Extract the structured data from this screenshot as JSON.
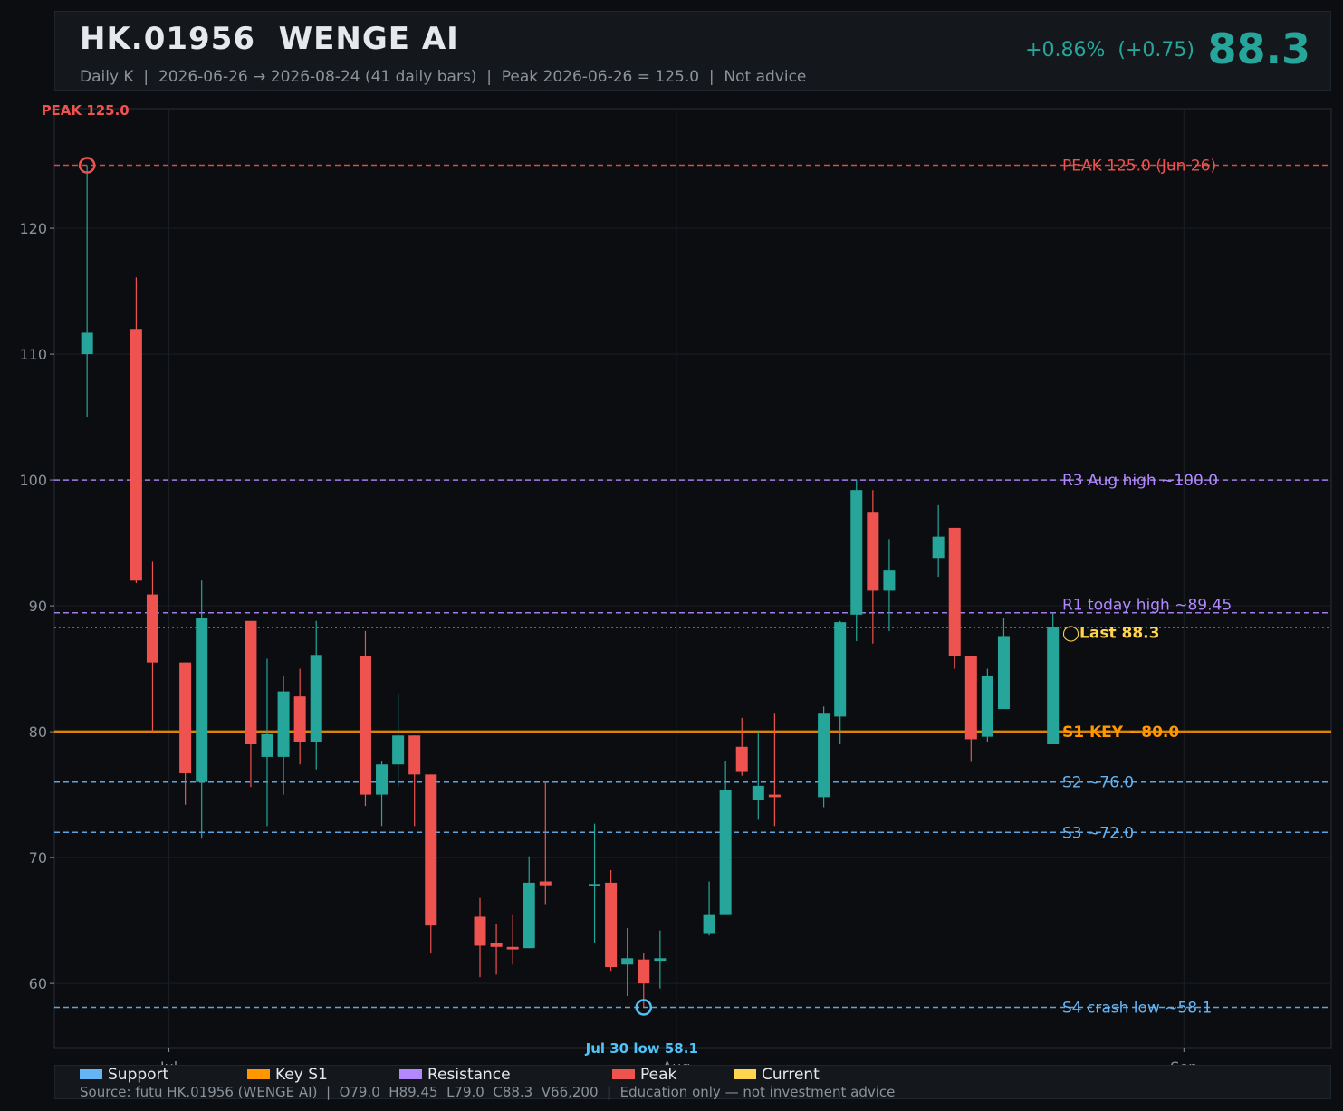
{
  "header": {
    "title": "HK.01956  WENGE AI",
    "subtitle": "Daily K  |  2026-06-26 → 2026-08-24 (41 daily bars)  |  Peak 2026-06-26 = 125.0  |  Not advice",
    "change": "+0.86%  (+0.75)",
    "price": "88.3"
  },
  "chart_data": {
    "type": "candlestick",
    "ylim": [
      54.9,
      129.5
    ],
    "yticks": [
      60,
      70,
      80,
      90,
      100,
      110,
      120
    ],
    "xticks": [
      {
        "label": "Jul",
        "date": "2026-07-01"
      },
      {
        "label": "Aug",
        "date": "2026-08-01"
      },
      {
        "label": "Sep",
        "date": "2026-09-01"
      }
    ],
    "x_range": [
      "2026-06-24",
      "2026-09-10"
    ],
    "grid": true,
    "candles": [
      {
        "date": "2026-06-26",
        "open": 110.0,
        "high": 125.0,
        "low": 105.0,
        "close": 111.7
      },
      {
        "date": "2026-06-29",
        "open": 112.0,
        "high": 116.1,
        "low": 91.8,
        "close": 92.0
      },
      {
        "date": "2026-06-30",
        "open": 90.9,
        "high": 93.5,
        "low": 80.0,
        "close": 85.5
      },
      {
        "date": "2026-07-02",
        "open": 85.5,
        "high": 85.5,
        "low": 74.2,
        "close": 76.7
      },
      {
        "date": "2026-07-03",
        "open": 76.0,
        "high": 92.0,
        "low": 71.5,
        "close": 89.0
      },
      {
        "date": "2026-07-06",
        "open": 88.8,
        "high": 88.8,
        "low": 75.6,
        "close": 79.0
      },
      {
        "date": "2026-07-07",
        "open": 78.0,
        "high": 85.8,
        "low": 72.5,
        "close": 79.8
      },
      {
        "date": "2026-07-08",
        "open": 78.0,
        "high": 84.4,
        "low": 75.0,
        "close": 83.2
      },
      {
        "date": "2026-07-09",
        "open": 82.8,
        "high": 85.0,
        "low": 77.4,
        "close": 79.2
      },
      {
        "date": "2026-07-10",
        "open": 79.2,
        "high": 88.8,
        "low": 77.0,
        "close": 86.1
      },
      {
        "date": "2026-07-13",
        "open": 86.0,
        "high": 88.0,
        "low": 74.1,
        "close": 75.0
      },
      {
        "date": "2026-07-14",
        "open": 75.0,
        "high": 77.7,
        "low": 72.5,
        "close": 77.4
      },
      {
        "date": "2026-07-15",
        "open": 77.4,
        "high": 83.0,
        "low": 75.6,
        "close": 79.7
      },
      {
        "date": "2026-07-16",
        "open": 79.7,
        "high": 79.7,
        "low": 72.5,
        "close": 76.6
      },
      {
        "date": "2026-07-17",
        "open": 76.6,
        "high": 76.6,
        "low": 62.4,
        "close": 64.6
      },
      {
        "date": "2026-07-20",
        "open": 65.3,
        "high": 66.8,
        "low": 60.5,
        "close": 63.0
      },
      {
        "date": "2026-07-21",
        "open": 63.2,
        "high": 64.7,
        "low": 60.7,
        "close": 62.9
      },
      {
        "date": "2026-07-22",
        "open": 62.9,
        "high": 65.5,
        "low": 61.5,
        "close": 62.7
      },
      {
        "date": "2026-07-23",
        "open": 62.8,
        "high": 70.1,
        "low": 62.8,
        "close": 68.0
      },
      {
        "date": "2026-07-24",
        "open": 68.1,
        "high": 76.1,
        "low": 66.3,
        "close": 67.8
      },
      {
        "date": "2026-07-27",
        "open": 67.8,
        "high": 72.7,
        "low": 63.2,
        "close": 67.9
      },
      {
        "date": "2026-07-28",
        "open": 68.0,
        "high": 69.0,
        "low": 61.0,
        "close": 61.3
      },
      {
        "date": "2026-07-29",
        "open": 61.5,
        "high": 64.4,
        "low": 59.0,
        "close": 62.0
      },
      {
        "date": "2026-07-30",
        "open": 61.9,
        "high": 62.4,
        "low": 58.1,
        "close": 60.0
      },
      {
        "date": "2026-07-31",
        "open": 61.8,
        "high": 64.2,
        "low": 59.6,
        "close": 62.0
      },
      {
        "date": "2026-08-03",
        "open": 64.0,
        "high": 68.1,
        "low": 63.8,
        "close": 65.5
      },
      {
        "date": "2026-08-04",
        "open": 65.5,
        "high": 77.7,
        "low": 65.5,
        "close": 75.4
      },
      {
        "date": "2026-08-05",
        "open": 78.8,
        "high": 81.1,
        "low": 76.5,
        "close": 76.8
      },
      {
        "date": "2026-08-06",
        "open": 74.6,
        "high": 80.0,
        "low": 73.0,
        "close": 75.7
      },
      {
        "date": "2026-08-07",
        "open": 75.0,
        "high": 81.5,
        "low": 72.5,
        "close": 74.8
      },
      {
        "date": "2026-08-10",
        "open": 74.8,
        "high": 82.0,
        "low": 74.0,
        "close": 81.5
      },
      {
        "date": "2026-08-11",
        "open": 81.2,
        "high": 88.8,
        "low": 79.0,
        "close": 88.7
      },
      {
        "date": "2026-08-12",
        "open": 89.3,
        "high": 100.0,
        "low": 87.2,
        "close": 99.2
      },
      {
        "date": "2026-08-13",
        "open": 97.4,
        "high": 99.2,
        "low": 87.0,
        "close": 91.2
      },
      {
        "date": "2026-08-14",
        "open": 91.2,
        "high": 95.3,
        "low": 88.0,
        "close": 92.8
      },
      {
        "date": "2026-08-17",
        "open": 93.8,
        "high": 98.0,
        "low": 92.3,
        "close": 95.5
      },
      {
        "date": "2026-08-18",
        "open": 96.2,
        "high": 96.2,
        "low": 85.0,
        "close": 86.0
      },
      {
        "date": "2026-08-19",
        "open": 86.0,
        "high": 86.0,
        "low": 77.6,
        "close": 79.4
      },
      {
        "date": "2026-08-20",
        "open": 79.6,
        "high": 85.0,
        "low": 79.2,
        "close": 84.4
      },
      {
        "date": "2026-08-21",
        "open": 81.8,
        "high": 89.0,
        "low": 81.8,
        "close": 87.6
      },
      {
        "date": "2026-08-24",
        "open": 79.0,
        "high": 89.45,
        "low": 79.0,
        "close": 88.3
      }
    ],
    "levels": [
      {
        "key": "peak",
        "value": 125.0,
        "label": "PEAK 125.0 (Jun 26)",
        "color": "#ef5350",
        "style": "dashed"
      },
      {
        "key": "r3",
        "value": 100.0,
        "label": "R3 Aug high ~100.0",
        "color": "#b388ff",
        "style": "dashed"
      },
      {
        "key": "r1",
        "value": 89.45,
        "label": "R1 today high ~89.45",
        "color": "#b388ff",
        "style": "dashed"
      },
      {
        "key": "current",
        "value": 88.3,
        "label": "◯Last 88.3",
        "color": "#ffd54f",
        "style": "dotted"
      },
      {
        "key": "s1",
        "value": 80.0,
        "label": "S1 KEY ~80.0",
        "color": "#ff9800",
        "style": "solid"
      },
      {
        "key": "s2",
        "value": 76.0,
        "label": "S2 ~76.0",
        "color": "#64b5f6",
        "style": "dashed"
      },
      {
        "key": "s3",
        "value": 72.0,
        "label": "S3 ~72.0",
        "color": "#64b5f6",
        "style": "dashed"
      },
      {
        "key": "s4",
        "value": 58.1,
        "label": "S4 crash low ~58.1",
        "color": "#64b5f6",
        "style": "dashed"
      }
    ],
    "annotations": [
      {
        "date": "2026-06-26",
        "value": 125.0,
        "label": "PEAK 125.0",
        "color": "#ef5350",
        "position": "above-left"
      },
      {
        "date": "2026-07-30",
        "value": 58.1,
        "label": "Jul 30 low 58.1",
        "color": "#4fc3f7",
        "position": "below"
      }
    ],
    "colors": {
      "up": "#26a69a",
      "down": "#ef5350"
    }
  },
  "legend": {
    "items": [
      {
        "label": "Support",
        "color": "#64b5f6"
      },
      {
        "label": "Key S1",
        "color": "#ff9800"
      },
      {
        "label": "Resistance",
        "color": "#b388ff"
      },
      {
        "label": "Peak",
        "color": "#ef5350"
      },
      {
        "label": "Current",
        "color": "#ffd54f"
      }
    ],
    "source": "Source: futu HK.01956 (WENGE AI)  |  O79.0  H89.45  L79.0  C88.3  V66,200  |  Education only — not investment advice"
  }
}
